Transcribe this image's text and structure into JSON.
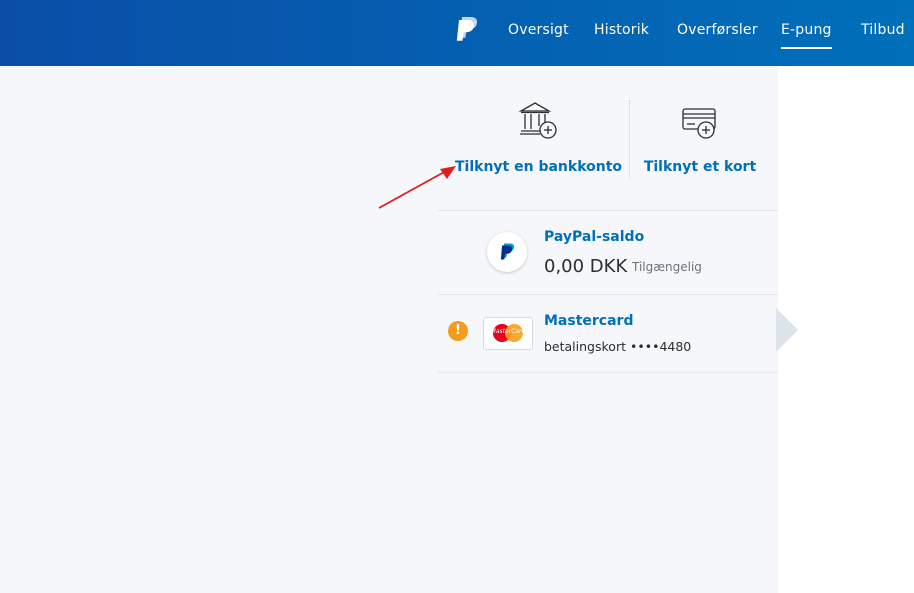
{
  "nav": {
    "logo": "paypal-logo",
    "items": [
      {
        "label": "Oversigt",
        "active": false
      },
      {
        "label": "Historik",
        "active": false
      },
      {
        "label": "Overførsler",
        "active": false
      },
      {
        "label": "E-pung",
        "active": true
      },
      {
        "label": "Tilbud",
        "active": false
      }
    ]
  },
  "actions": {
    "bank": {
      "label": "Tilknyt en bankkonto",
      "icon": "bank-add-icon"
    },
    "card": {
      "label": "Tilknyt et kort",
      "icon": "card-add-icon"
    }
  },
  "wallet": {
    "paypal": {
      "title": "PayPal-saldo",
      "amount": "0,00 DKK",
      "status": "Tilgængelig"
    },
    "card": {
      "warning": "!",
      "title": "Mastercard",
      "logo_text": "MasterCard",
      "detail": "betalingskort ••••4480"
    }
  },
  "colors": {
    "brand_blue": "#0070ba",
    "header_dark": "#0a4ea8",
    "warning": "#f59b1c",
    "annotation_arrow": "#e11d1d"
  }
}
